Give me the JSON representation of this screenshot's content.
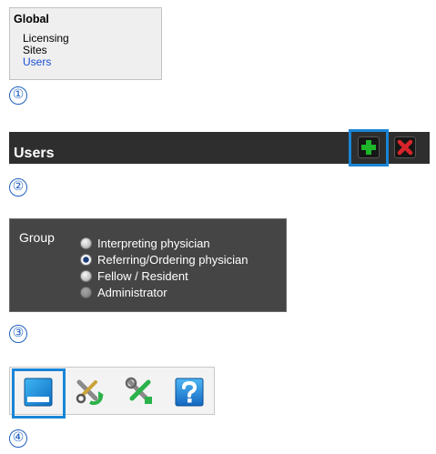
{
  "global_panel": {
    "title": "Global",
    "items": [
      {
        "label": "Licensing",
        "active": false
      },
      {
        "label": "Sites",
        "active": false
      },
      {
        "label": "Users",
        "active": true
      }
    ]
  },
  "users_toolbar": {
    "title": "Users",
    "add_icon": "plus-icon",
    "delete_icon": "close-icon"
  },
  "group_selector": {
    "label": "Group",
    "options": [
      {
        "label": "Interpreting physician",
        "state": "unchecked"
      },
      {
        "label": "Referring/Ordering physician",
        "state": "checked"
      },
      {
        "label": "Fellow / Resident",
        "state": "unchecked"
      },
      {
        "label": "Administrator",
        "state": "disabled"
      }
    ]
  },
  "icon_toolbar": {
    "icons": [
      "window-icon",
      "tools-refresh-icon",
      "tools-settings-icon",
      "help-icon"
    ]
  },
  "steps": [
    "①",
    "②",
    "③",
    "④"
  ],
  "colors": {
    "highlight": "#1a85d6",
    "link_active": "#1a4fd6",
    "add_green": "#1db52a",
    "delete_red": "#d8252b",
    "dark_bar": "#2e2e2e",
    "group_bg": "#454545"
  }
}
